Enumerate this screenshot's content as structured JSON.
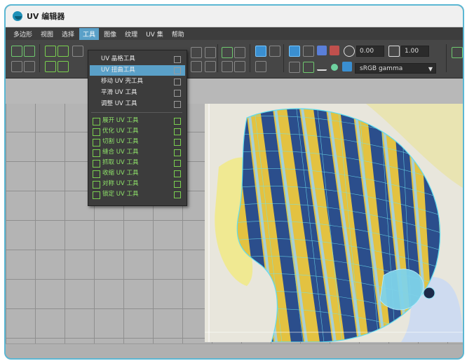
{
  "window": {
    "title": "UV 编辑器"
  },
  "menubar": {
    "items": [
      {
        "label": "多边形"
      },
      {
        "label": "视图"
      },
      {
        "label": "选择"
      },
      {
        "label": "工具",
        "active": true
      },
      {
        "label": "图像"
      },
      {
        "label": "纹理"
      },
      {
        "label": "UV 集"
      },
      {
        "label": "帮助"
      }
    ]
  },
  "toolbar": {
    "field_low": "0.00",
    "field_high": "1.00",
    "color_space": "sRGB gamma"
  },
  "tools_menu": {
    "group1": [
      {
        "label": "UV 晶格工具"
      },
      {
        "label": "UV 扭曲工具"
      },
      {
        "label": "移动 UV 壳工具"
      },
      {
        "label": "平滑 UV 工具"
      },
      {
        "label": "调整 UV 工具"
      }
    ],
    "group2": [
      {
        "label": "展开 UV 工具"
      },
      {
        "label": "优化 UV 工具"
      },
      {
        "label": "切割 UV 工具"
      },
      {
        "label": "缝合 UV 工具"
      },
      {
        "label": "抓取 UV 工具"
      },
      {
        "label": "收缩 UV 工具"
      },
      {
        "label": "对称 UV 工具"
      },
      {
        "label": "锁定 UV 工具"
      }
    ]
  },
  "colors": {
    "accent": "#5aa0c8",
    "frame": "#5bb7d3",
    "green_tool": "#8fe36a",
    "fish_yellow": "#e3c241",
    "fish_blue": "#2b4e8c",
    "wire": "#6fe3ef"
  }
}
